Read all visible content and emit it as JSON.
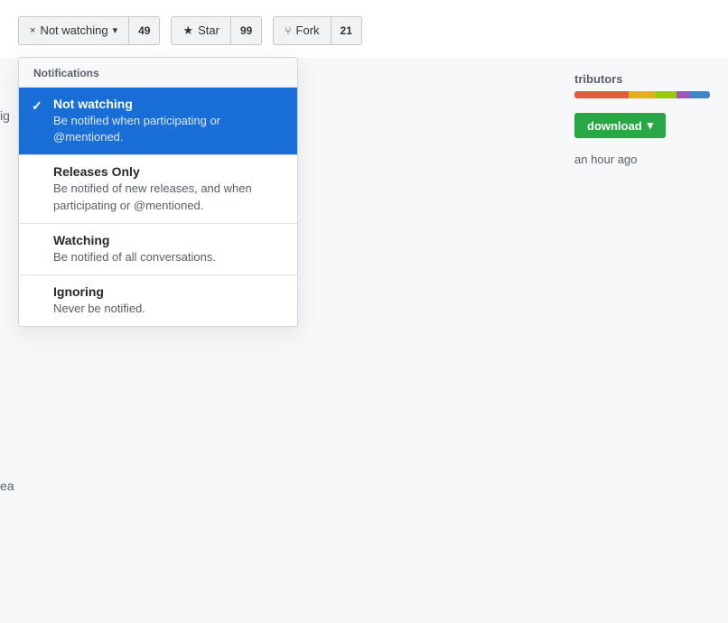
{
  "header": {
    "watch_label": "Not watching",
    "watch_count": "49",
    "star_label": "Star",
    "star_count": "99",
    "fork_label": "Fork",
    "fork_count": "21"
  },
  "dropdown": {
    "header": "Notifications",
    "items": [
      {
        "id": "not-watching",
        "title": "Not watching",
        "desc": "Be notified when participating or @mentioned.",
        "selected": true
      },
      {
        "id": "releases-only",
        "title": "Releases Only",
        "desc": "Be notified of new releases, and when participating or @mentioned.",
        "selected": false
      },
      {
        "id": "watching",
        "title": "Watching",
        "desc": "Be notified of all conversations.",
        "selected": false
      },
      {
        "id": "ignoring",
        "title": "Ignoring",
        "desc": "Never be notified.",
        "selected": false
      }
    ]
  },
  "sidebar": {
    "contributors_label": "tributors",
    "download_label": "download",
    "time_label": "an hour ago"
  },
  "icons": {
    "x": "×",
    "chevron": "▾",
    "star": "★",
    "fork": "⑂",
    "checkmark": "✓",
    "download_chevron": "▾"
  }
}
